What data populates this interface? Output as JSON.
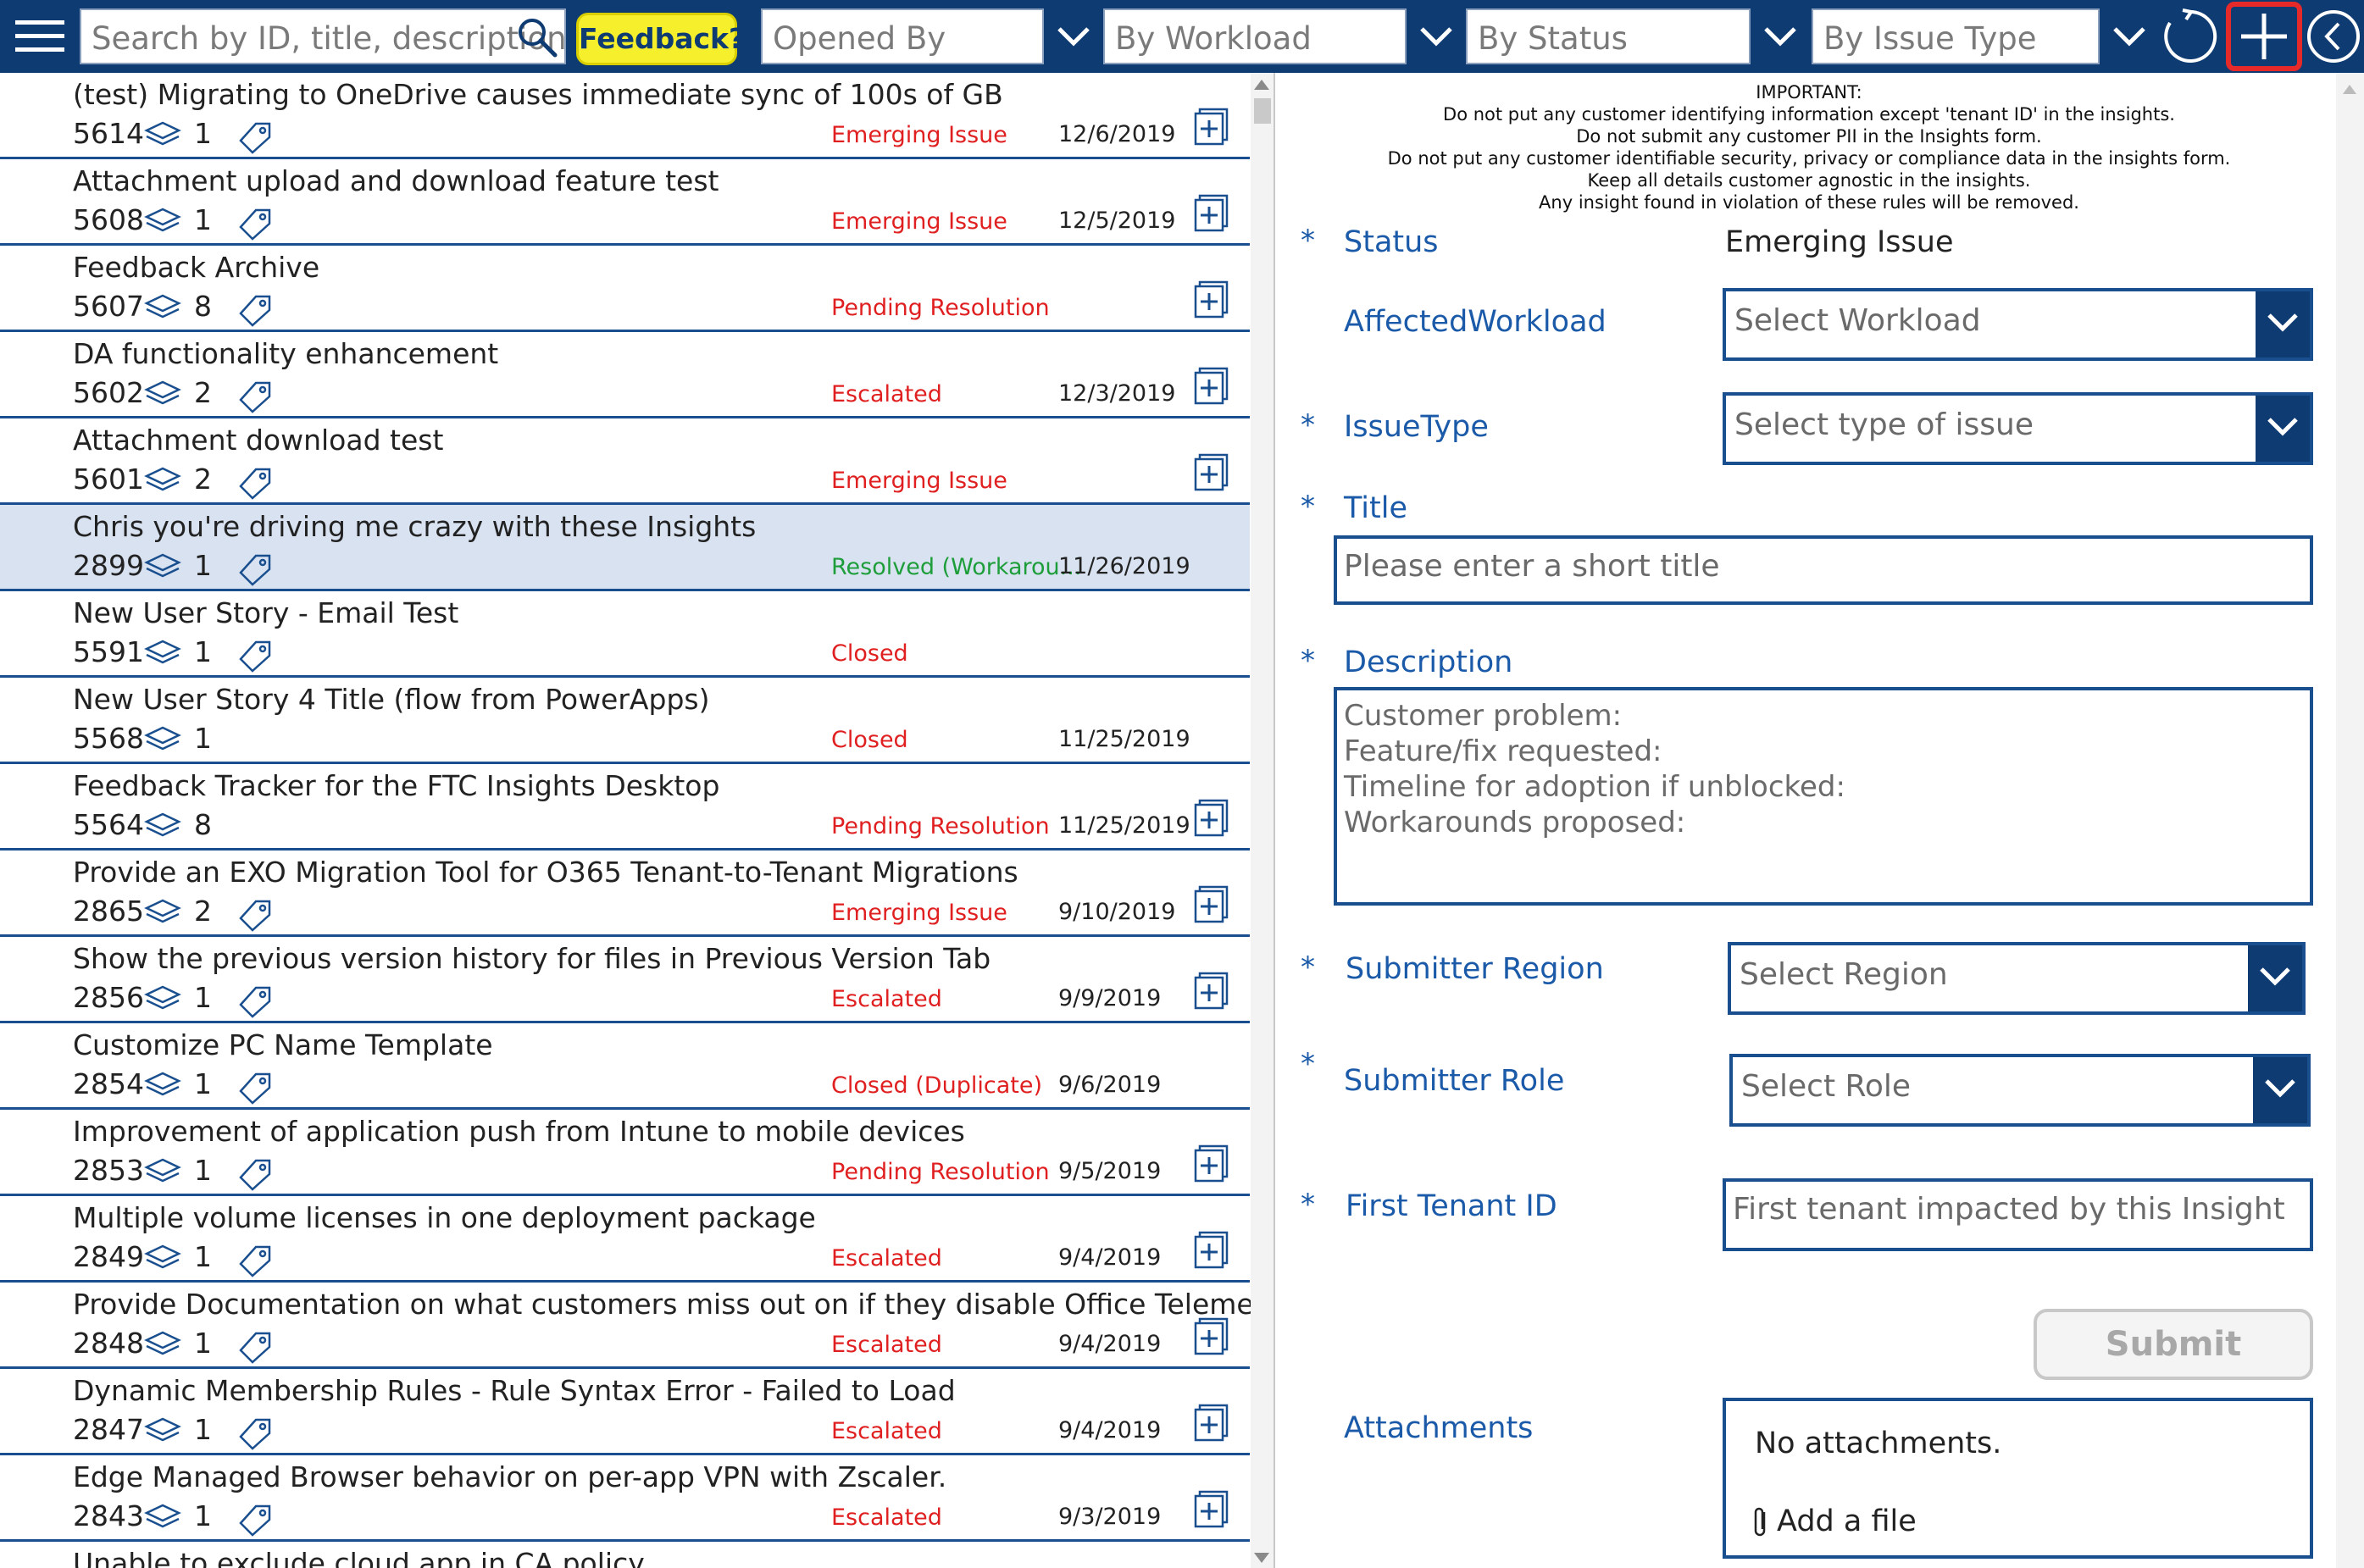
{
  "topbar": {
    "search_placeholder": "Search by ID, title, description",
    "feedback_label": "Feedback?",
    "filters": [
      "Opened By",
      "By Workload",
      "By Status",
      "By Issue Type"
    ]
  },
  "list": {
    "rows": [
      {
        "title": "(test) Migrating to OneDrive causes immediate sync of 100s of GB",
        "id": "5614",
        "count": "1",
        "status": "Emerging Issue",
        "date": "12/6/2019",
        "has_tag": true,
        "has_add": true,
        "status_color": "red"
      },
      {
        "title": "Attachment upload and download feature test",
        "id": "5608",
        "count": "1",
        "status": "Emerging Issue",
        "date": "12/5/2019",
        "has_tag": true,
        "has_add": true,
        "status_color": "red"
      },
      {
        "title": "Feedback Archive",
        "id": "5607",
        "count": "8",
        "status": "Pending Resolution",
        "date": "",
        "has_tag": true,
        "has_add": true,
        "status_color": "red"
      },
      {
        "title": "DA functionality enhancement",
        "id": "5602",
        "count": "2",
        "status": "Escalated",
        "date": "12/3/2019",
        "has_tag": true,
        "has_add": true,
        "status_color": "red"
      },
      {
        "title": "Attachment download test",
        "id": "5601",
        "count": "2",
        "status": "Emerging Issue",
        "date": "",
        "has_tag": true,
        "has_add": true,
        "status_color": "red"
      },
      {
        "title": "Chris you're driving me crazy with these Insights",
        "id": "2899",
        "count": "1",
        "status": "Resolved (Workarou...",
        "date": "11/26/2019",
        "has_tag": true,
        "has_add": false,
        "status_color": "green",
        "selected": true
      },
      {
        "title": "New User Story - Email Test",
        "id": "5591",
        "count": "1",
        "status": "Closed",
        "date": "",
        "has_tag": true,
        "has_add": false,
        "status_color": "red"
      },
      {
        "title": "New User Story 4 Title (flow from PowerApps)",
        "id": "5568",
        "count": "1",
        "status": "Closed",
        "date": "11/25/2019",
        "has_tag": false,
        "has_add": false,
        "status_color": "red"
      },
      {
        "title": "Feedback Tracker for the FTC Insights Desktop",
        "id": "5564",
        "count": "8",
        "status": "Pending Resolution",
        "date": "11/25/2019",
        "has_tag": false,
        "has_add": true,
        "status_color": "red"
      },
      {
        "title": "Provide an EXO Migration Tool for O365 Tenant-to-Tenant Migrations",
        "id": "2865",
        "count": "2",
        "status": "Emerging Issue",
        "date": "9/10/2019",
        "has_tag": true,
        "has_add": true,
        "status_color": "red"
      },
      {
        "title": "Show the previous version history for files in Previous Version Tab",
        "id": "2856",
        "count": "1",
        "status": "Escalated",
        "date": "9/9/2019",
        "has_tag": true,
        "has_add": true,
        "status_color": "red"
      },
      {
        "title": "Customize PC Name Template",
        "id": "2854",
        "count": "1",
        "status": "Closed (Duplicate)",
        "date": "9/6/2019",
        "has_tag": true,
        "has_add": false,
        "status_color": "red"
      },
      {
        "title": "Improvement of application push from Intune to mobile devices",
        "id": "2853",
        "count": "1",
        "status": "Pending Resolution",
        "date": "9/5/2019",
        "has_tag": true,
        "has_add": true,
        "status_color": "red"
      },
      {
        "title": "Multiple volume licenses in one deployment package",
        "id": "2849",
        "count": "1",
        "status": "Escalated",
        "date": "9/4/2019",
        "has_tag": true,
        "has_add": true,
        "status_color": "red"
      },
      {
        "title": "Provide Documentation on what customers miss out on if they disable Office Telemetry",
        "id": "2848",
        "count": "1",
        "status": "Escalated",
        "date": "9/4/2019",
        "has_tag": true,
        "has_add": true,
        "status_color": "red"
      },
      {
        "title": "Dynamic Membership Rules - Rule Syntax Error - Failed to Load",
        "id": "2847",
        "count": "1",
        "status": "Escalated",
        "date": "9/4/2019",
        "has_tag": true,
        "has_add": true,
        "status_color": "red"
      },
      {
        "title": "Edge Managed Browser behavior on per-app VPN with Zscaler.",
        "id": "2843",
        "count": "1",
        "status": "Escalated",
        "date": "9/3/2019",
        "has_tag": true,
        "has_add": true,
        "status_color": "red"
      },
      {
        "title": "Unable to exclude cloud app in CA policy",
        "id": "",
        "count": "",
        "status": "",
        "date": "",
        "has_tag": false,
        "has_add": false,
        "status_color": "red"
      }
    ]
  },
  "form": {
    "notice": [
      "IMPORTANT:",
      "Do not put any customer identifying information except 'tenant ID' in the insights.",
      "Do not submit any customer PII in the Insights form.",
      "Do not put any customer identifiable security, privacy or compliance data in the insights form.",
      "Keep all details customer agnostic in the insights.",
      "Any insight found in violation of these rules will be removed."
    ],
    "status_label": "Status",
    "status_value": "Emerging Issue",
    "workload_label": "AffectedWorkload",
    "workload_placeholder": "Select Workload",
    "issuetype_label": "IssueType",
    "issuetype_placeholder": "Select type of issue",
    "title_label": "Title",
    "title_placeholder": "Please enter a short title",
    "description_label": "Description",
    "description_placeholder_lines": [
      "Customer problem:",
      "Feature/fix requested:",
      "Timeline for adoption if unblocked:",
      "Workarounds proposed:"
    ],
    "region_label": "Submitter Region",
    "region_placeholder": "Select Region",
    "role_label": "Submitter Role",
    "role_placeholder": "Select Role",
    "tenant_label": "First Tenant ID",
    "tenant_placeholder": "First tenant impacted by this Insight",
    "submit_label": "Submit",
    "attachments_label": "Attachments",
    "no_attachments": "No attachments.",
    "add_file": "Add a file",
    "required_mark": "*"
  },
  "colors": {
    "brand": "#0f3b73",
    "accent_blue": "#1a5aa8",
    "status_red": "#e02020",
    "status_green": "#1e9e3a",
    "feedback_yellow": "#f6ef2b",
    "highlight_red": "#e62a2a",
    "selected_row": "#d8e2f1"
  },
  "icons": [
    "menu-icon",
    "search-icon",
    "chevron-down-icon",
    "refresh-icon",
    "add-icon",
    "back-icon",
    "layers-icon",
    "tag-icon",
    "add-document-icon",
    "paperclip-icon"
  ]
}
